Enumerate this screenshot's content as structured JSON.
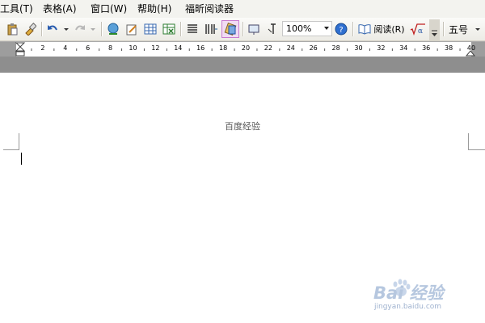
{
  "menu": {
    "items": [
      "工具(T)",
      "表格(A)",
      "窗口(W)",
      "帮助(H)",
      "福昕阅读器"
    ]
  },
  "toolbar": {
    "zoom_value": "100%",
    "read_label": "阅读(R)",
    "font_size": "五号"
  },
  "ruler": {
    "numbers": [
      "2",
      "4",
      "6",
      "8",
      "10",
      "12",
      "14",
      "16",
      "18",
      "20",
      "22",
      "24",
      "26",
      "28",
      "30",
      "32",
      "34",
      "36",
      "38",
      "40"
    ]
  },
  "document": {
    "header_text": "百度经验"
  },
  "watermark": {
    "brand": "Bai 经验",
    "url": "jingyan.baidu.com"
  },
  "colors": {
    "menubar_bg": "#f3f3ef",
    "workspace_gray": "#8e8e8e",
    "active_tool": "#c87ad0",
    "watermark": "#b6c7df"
  }
}
